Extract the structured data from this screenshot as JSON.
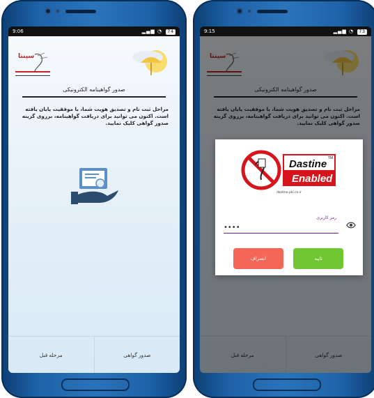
{
  "left_phone": {
    "status": {
      "time": "9:06",
      "battery": "74"
    },
    "app": {
      "logo_text": "سپنتا",
      "title": "صدور گواهینامه الکترونیکی",
      "description": "مراحل ثبت نام و تصدیق هویت شما، با موفقیت پایان یافته است. اکنون می توانید برای دریافت گواهینامه، برروی گزینه صدور گواهی کلیک نمایید.",
      "btn_issue": "صدور گواهی",
      "btn_prev": "مرحله قبل"
    }
  },
  "right_phone": {
    "status": {
      "time": "9:15",
      "battery": "73"
    },
    "app": {
      "logo_text": "سپنتا",
      "title": "صدور گواهینامه الکترونیکی",
      "description": "مراحل ثبت نام و تصدیق هویت شما، با موفقیت پایان یافته است. اکنون می توانید برای دریافت گواهینامه، برروی گزینه صدور گواهی کلیک نمایید.",
      "btn_issue": "صدور گواهی",
      "btn_prev": "مرحله قبل"
    },
    "dialog": {
      "brand_line1": "Dastine",
      "brand_tm": "TM",
      "brand_line2": "Enabled",
      "url": "dastine.pki.co.ir",
      "password_label": "رمز کاربری",
      "password_value": "••••",
      "cancel_label": "انصراف",
      "confirm_label": "تایید"
    }
  },
  "colors": {
    "frame": "#1e62a8",
    "title_rule": "#222222",
    "confirm": "#70c733",
    "cancel": "#f26757",
    "dastine_red": "#d7141b"
  }
}
